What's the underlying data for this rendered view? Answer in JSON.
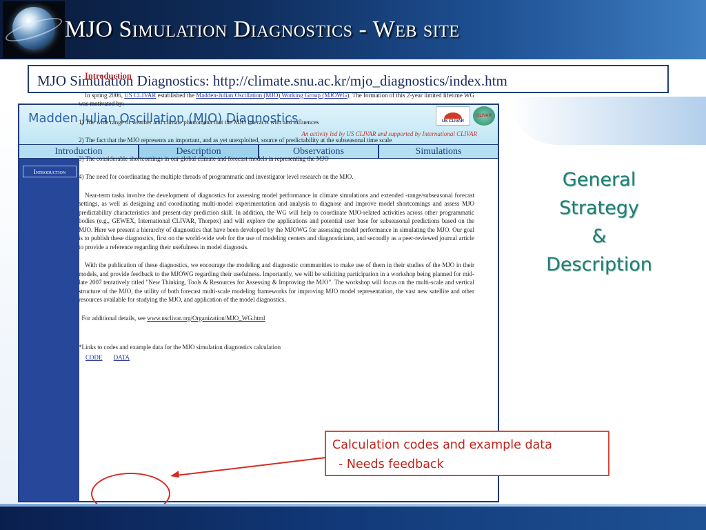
{
  "slide": {
    "title": "MJO Simulation Diagnostics - Web site",
    "url_line": "MJO Simulation Diagnostics: http://climate.snu.ac.kr/mjo_diagnostics/index.htm"
  },
  "webpage": {
    "title": "Madden Julian Oscillation (MJO) Diagnostics",
    "subtitle": "An activity led by US CLIVAR and supported by International CLIVAR",
    "logos": {
      "usclivar": "US CLIVAR",
      "clivar": "CLIVAR"
    },
    "nav": [
      {
        "label": "Introduction",
        "active": false
      },
      {
        "label": "Description",
        "active": true
      },
      {
        "label": "Observations",
        "active": false
      },
      {
        "label": "Simulations",
        "active": false
      }
    ],
    "sidebar_button": "Introduction",
    "heading": "Introduction",
    "intro": {
      "lead": "In spring 2006,",
      "link1": "US CLIVAR",
      "mid": "established the",
      "link2": "Madden-Julian Oscillation (MJO) Working Group (MJOWG)",
      "tail": ". The formation of this 2-year limited lifetime WG was motivated by:"
    },
    "points": [
      "1) The wide range of weather and climate phenomena that the MJO interacts with and influences",
      "2) The fact that the MJO represents an important, and as yet unexploited, source of predictability at the subseasonal time scale",
      "3) The considerable shortcomings in our global climate and forecast models in representing the MJO",
      "4) The need for coordinating the multiple threads of programmatic and investigator level research on the MJO."
    ],
    "paragraph_near_term": "Near-term tasks involve the development of diagnostics for assessing model performance in climate simulations and extended -range/subseasonal forecast settings, as well as designing and coordinating multi-model experimentation and analysis to diagnose and improve model shortcomings and assess MJO predictability characteristics and present-day prediction skill. In addition, the WG will help to coordinate MJO-related activities across other programmatic bodies (e.g., GEWEX, International CLIVAR, Thorpex) and will explore the applications and potential user base for subseasonal predictions based on the MJO. Here we present a hierarchy of diagnostics that have been developed by the MJOWG for assessing model performance in simulating the MJO. Our goal is to publish these diagnostics, first on the world-wide web for the use of modeling centers and diagnosticians, and secondly as a peer-reviewed journal article to provide a reference regarding their usefulness in model diagnosis.",
    "paragraph_publication": "With the publication of these diagnostics, we encourage the modeling and diagnostic communities to make use of them in their studies of the MJO in their models, and provide feedback to the MJOWG regarding their usefulness. Importantly, we will be soliciting participation in a workshop being planned for mid-late 2007 tentatively titled \"New Thinking, Tools & Resources for Assessing & Improving the MJO\". The workshop will focus on the multi-scale and vertical structure of the MJO, the utility of both forecast multi-scale modeling frameworks for improving MJO model representation, the vast new satellite and other resources available for studying the MJO, and application of the model diagnostics.",
    "details": {
      "prefix": "For additional details, see",
      "link": "www.usclivar.org/Organization/MJO_WG.html"
    },
    "links_note": "*Links to codes and example data for the MJO simulation diagnostics calculation",
    "code_link": "CODE",
    "data_link": "DATA"
  },
  "strategy": {
    "line1": "General",
    "line2": "Strategy",
    "line3": "&",
    "line4": "Description"
  },
  "callout": {
    "line1": "Calculation codes and example data",
    "line2": "- Needs feedback"
  },
  "colors": {
    "header_dark": "#0f2d5c",
    "strategy_text": "#1e7f73",
    "callout_red": "#c0231a",
    "sidebar_blue": "#26479a"
  }
}
